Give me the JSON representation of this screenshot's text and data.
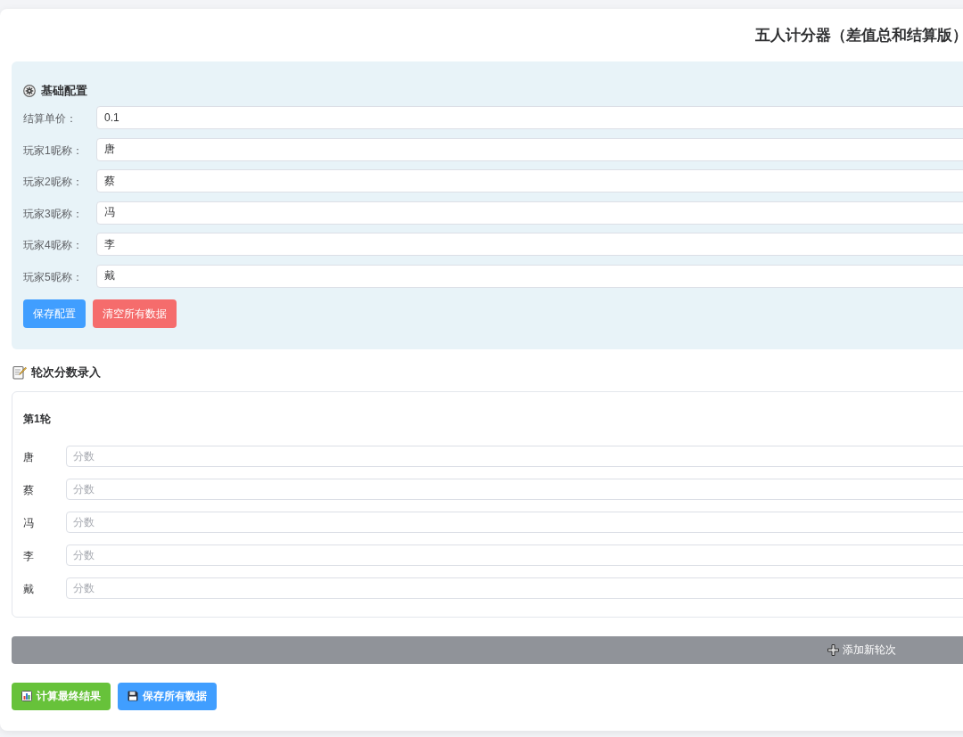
{
  "title": "五人计分器（差值总和结算版）",
  "config": {
    "heading": "基础配置",
    "fields": [
      {
        "label": "结算单价：",
        "value": "0.1"
      },
      {
        "label": "玩家1昵称：",
        "value": "唐"
      },
      {
        "label": "玩家2昵称：",
        "value": "蔡"
      },
      {
        "label": "玩家3昵称：",
        "value": "冯"
      },
      {
        "label": "玩家4昵称：",
        "value": "李"
      },
      {
        "label": "玩家5昵称：",
        "value": "戴"
      }
    ],
    "buttons": [
      {
        "label": "保存配置",
        "kind": "primary"
      },
      {
        "label": "清空所有数据",
        "kind": "danger"
      }
    ]
  },
  "rounds_section": {
    "heading": "轮次分数录入",
    "rounds": [
      {
        "title": "第1轮",
        "entries": [
          {
            "name": "唐",
            "placeholder": "分数"
          },
          {
            "name": "蔡",
            "placeholder": "分数"
          },
          {
            "name": "冯",
            "placeholder": "分数"
          },
          {
            "name": "李",
            "placeholder": "分数"
          },
          {
            "name": "戴",
            "placeholder": "分数"
          }
        ]
      }
    ]
  },
  "add_round_button": "添加新轮次",
  "actions": [
    {
      "label": "计算最终结果",
      "kind": "calculate"
    },
    {
      "label": "保存所有数据",
      "kind": "save"
    }
  ]
}
